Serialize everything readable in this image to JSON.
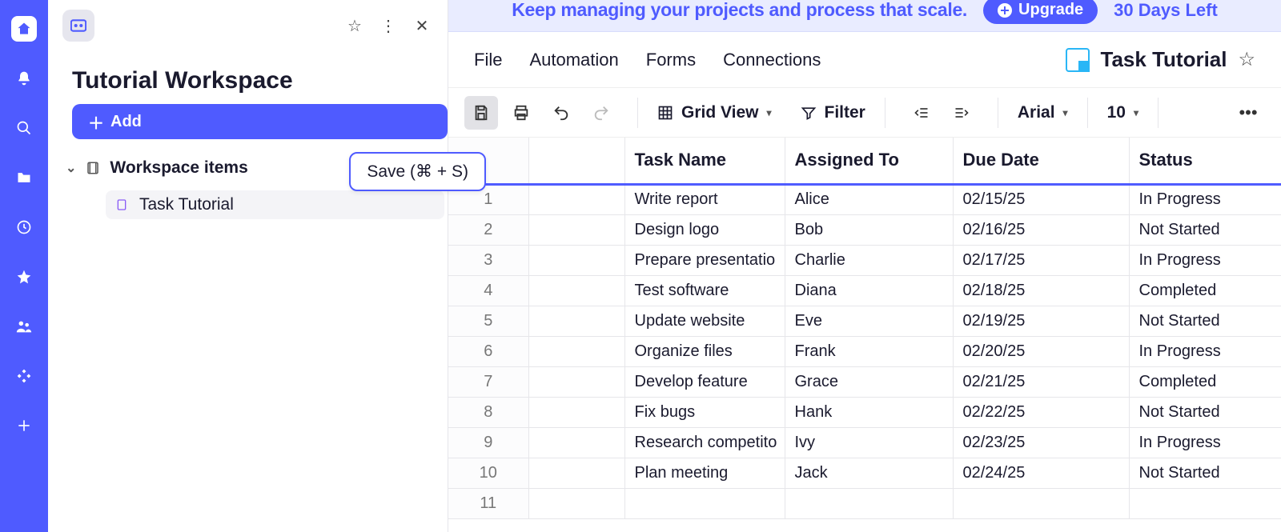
{
  "sidebar": {
    "logo_label": "::",
    "title": "Tutorial Workspace",
    "add_label": "Add",
    "tree_header": "Workspace items",
    "items": [
      {
        "label": "Task Tutorial"
      }
    ]
  },
  "tooltip": {
    "save": "Save (⌘ + S)"
  },
  "banner": {
    "text": "Keep managing your projects and process that scale.",
    "upgrade": "Upgrade",
    "trial": "30 Days Left"
  },
  "menu": {
    "file": "File",
    "automation": "Automation",
    "forms": "Forms",
    "connections": "Connections",
    "doc_title": "Task Tutorial"
  },
  "toolbar": {
    "view": "Grid View",
    "filter": "Filter",
    "font": "Arial",
    "size": "10"
  },
  "grid": {
    "headers": {
      "blank": "",
      "task": "Task Name",
      "assigned": "Assigned To",
      "due": "Due Date",
      "status": "Status"
    },
    "rows": [
      {
        "n": "1",
        "task": "Write report",
        "assigned": "Alice",
        "due": "02/15/25",
        "status": "In Progress"
      },
      {
        "n": "2",
        "task": "Design logo",
        "assigned": "Bob",
        "due": "02/16/25",
        "status": "Not Started"
      },
      {
        "n": "3",
        "task": "Prepare presentatio",
        "assigned": "Charlie",
        "due": "02/17/25",
        "status": "In Progress"
      },
      {
        "n": "4",
        "task": "Test software",
        "assigned": "Diana",
        "due": "02/18/25",
        "status": "Completed"
      },
      {
        "n": "5",
        "task": "Update website",
        "assigned": "Eve",
        "due": "02/19/25",
        "status": "Not Started"
      },
      {
        "n": "6",
        "task": "Organize files",
        "assigned": "Frank",
        "due": "02/20/25",
        "status": "In Progress"
      },
      {
        "n": "7",
        "task": "Develop feature",
        "assigned": "Grace",
        "due": "02/21/25",
        "status": "Completed"
      },
      {
        "n": "8",
        "task": "Fix bugs",
        "assigned": "Hank",
        "due": "02/22/25",
        "status": "Not Started"
      },
      {
        "n": "9",
        "task": "Research competito",
        "assigned": "Ivy",
        "due": "02/23/25",
        "status": "In Progress"
      },
      {
        "n": "10",
        "task": "Plan meeting",
        "assigned": "Jack",
        "due": "02/24/25",
        "status": "Not Started"
      },
      {
        "n": "11",
        "task": "",
        "assigned": "",
        "due": "",
        "status": ""
      }
    ]
  }
}
